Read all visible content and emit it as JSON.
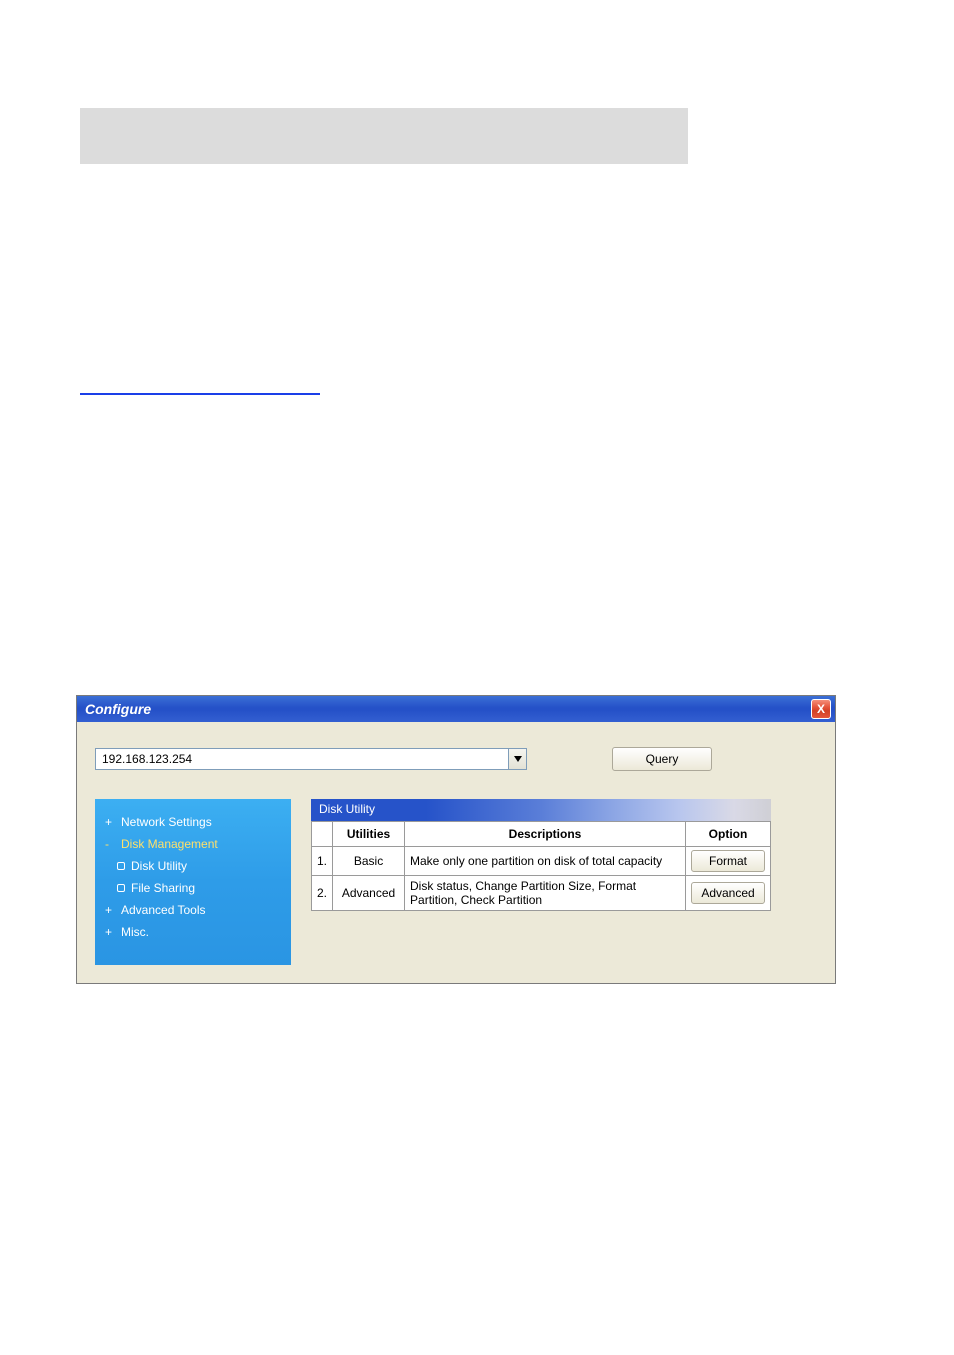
{
  "window": {
    "title": "Configure",
    "close_icon": "X"
  },
  "ipbar": {
    "value": "192.168.123.254",
    "query_label": "Query"
  },
  "sidebar": {
    "items": [
      {
        "marker": "+",
        "label": "Network Settings",
        "highlight": false,
        "level": 1
      },
      {
        "marker": "-",
        "label": "Disk Management",
        "highlight": true,
        "level": 1
      },
      {
        "marker": "o",
        "label": "Disk Utility",
        "highlight": false,
        "level": 2
      },
      {
        "marker": "o",
        "label": "File Sharing",
        "highlight": false,
        "level": 2
      },
      {
        "marker": "+",
        "label": "Advanced Tools",
        "highlight": false,
        "level": 1
      },
      {
        "marker": "+",
        "label": "Misc.",
        "highlight": false,
        "level": 1
      }
    ]
  },
  "panel": {
    "title": "Disk Utility",
    "headers": {
      "utilities": "Utilities",
      "descriptions": "Descriptions",
      "option": "Option"
    },
    "rows": [
      {
        "num": "1.",
        "utility": "Basic",
        "description": "Make only one partition on disk of total capacity",
        "button": "Format"
      },
      {
        "num": "2.",
        "utility": "Advanced",
        "description": "Disk status, Change Partition Size, Format Partition, Check Partition",
        "button": "Advanced"
      }
    ]
  }
}
